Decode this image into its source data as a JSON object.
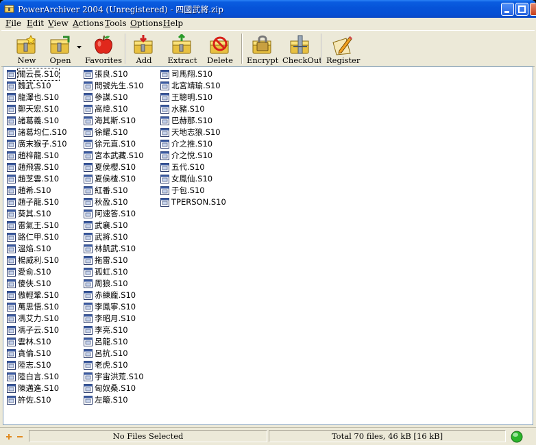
{
  "window": {
    "title": "PowerArchiver 2004 (Unregistered) - 四國武將.zip"
  },
  "menu": [
    {
      "key": "F",
      "rest": "ile"
    },
    {
      "key": "E",
      "rest": "dit"
    },
    {
      "key": "V",
      "rest": "iew"
    },
    {
      "key": "A",
      "rest": "ctions"
    },
    {
      "key": "T",
      "rest": "ools"
    },
    {
      "key": "O",
      "rest": "ptions"
    },
    {
      "key": "H",
      "rest": "elp"
    }
  ],
  "toolbar": {
    "new": "New",
    "open": "Open",
    "favorites": "Favorites",
    "add": "Add",
    "extract": "Extract",
    "delete": "Delete",
    "encrypt": "Encrypt",
    "checkout": "CheckOut",
    "register": "Register"
  },
  "files": [
    [
      "關云長.S10",
      "魏武.S10",
      "龍澤也.S10",
      "鄭天宏.S10",
      "諸葛義.S10",
      "諸葛均仁.S10",
      "廣末猴子.S10",
      "趙梓龍.S10",
      "趙飛雲.S10",
      "趙芝雲.S10",
      "趙希.S10",
      "趙子龍.S10",
      "葵其.S10",
      "雷氣王.S10",
      "路仁甲.S10",
      "溫焰.S10",
      "楊威利.S10",
      "愛俞.S10",
      "傻俠.S10",
      "傲輕鞏.S10",
      "萬思悟.S10",
      "馮艾力.S10",
      "馮子云.S10",
      "雲林.S10",
      "貪倫.S10",
      "陸志.S10",
      "陸白言.S10",
      "陳邁進.S10",
      "許佐.S10"
    ],
    [
      "張良.S10",
      "問號先生.S10",
      "參謀.S10",
      "高煒.S10",
      "海其斯.S10",
      "徐耀.S10",
      "徐元直.S10",
      "宮本武藏.S10",
      "夏侯櫻.S10",
      "夏侯楂.S10",
      "紅番.S10",
      "秋盈.S10",
      "阿速答.S10",
      "武襄.S10",
      "武將.S10",
      "林凱武.S10",
      "拖雷.S10",
      "孤虹.S10",
      "周狼.S10",
      "赤練龐.S10",
      "李鳳寧.S10",
      "李昭月.S10",
      "李亮.S10",
      "呂龍.S10",
      "呂抗.S10",
      "老虎.S10",
      "宇宙洪荒.S10",
      "匈奴桑.S10",
      "左簸.S10"
    ],
    [
      "司馬翔.S10",
      "北宮靖瑜.S10",
      "王聰明.S10",
      "水豬.S10",
      "巴赫那.S10",
      "天地志狼.S10",
      "介之推.S10",
      "介之悅.S10",
      "五代.S10",
      "女鳳仙.S10",
      "于包.S10",
      "TPERSON.S10"
    ]
  ],
  "status": {
    "selection": "No Files Selected",
    "total": "Total 70 files, 46 kB [16 kB]"
  },
  "colors": {
    "titlebar": "#0653d8",
    "face": "#ece9d8",
    "status_led": "#2bb52b"
  }
}
